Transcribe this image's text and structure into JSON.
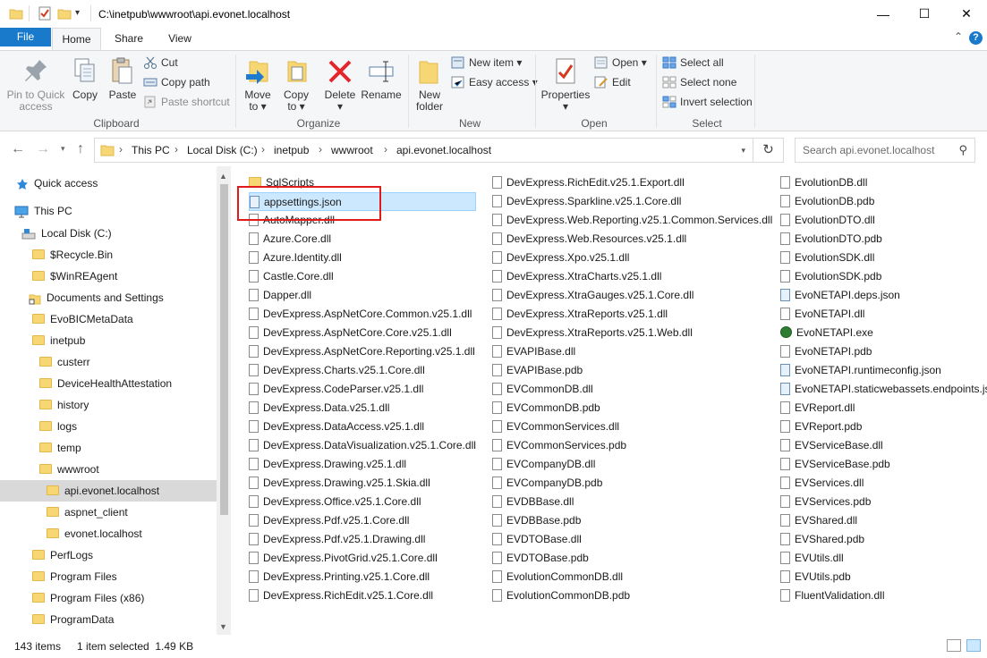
{
  "window": {
    "title": "C:\\inetpub\\wwwroot\\api.evonet.localhost",
    "controls": {
      "minimize": "—",
      "maximize": "☐",
      "close": "✕"
    }
  },
  "ribbon_tabs": [
    "File",
    "Home",
    "Share",
    "View"
  ],
  "ribbon": {
    "clipboard": {
      "pin_label_1": "Pin to Quick",
      "pin_label_2": "access",
      "copy": "Copy",
      "paste": "Paste",
      "cut": "Cut",
      "copy_path": "Copy path",
      "paste_shortcut": "Paste shortcut",
      "group": "Clipboard"
    },
    "organize": {
      "move_to_1": "Move",
      "move_to_2": "to ▾",
      "copy_to_1": "Copy",
      "copy_to_2": "to ▾",
      "delete_1": "Delete",
      "delete_2": "▾",
      "rename": "Rename",
      "group": "Organize"
    },
    "new": {
      "new_folder_1": "New",
      "new_folder_2": "folder",
      "new_item": "New item ▾",
      "easy_access": "Easy access ▾",
      "group": "New"
    },
    "open": {
      "properties_1": "Properties",
      "properties_2": "▾",
      "open": "Open ▾",
      "edit": "Edit",
      "group": "Open"
    },
    "select": {
      "select_all": "Select all",
      "select_none": "Select none",
      "invert_selection": "Invert selection",
      "group": "Select"
    },
    "collapse": "⌃",
    "help": "?"
  },
  "address": {
    "crumbs": [
      "This PC",
      "Local Disk (C:)",
      "inetpub",
      "wwwroot",
      "api.evonet.localhost"
    ],
    "search_placeholder": "Search api.evonet.localhost"
  },
  "nav_pane": [
    {
      "label": "Quick access",
      "type": "quick"
    },
    {
      "label": "This PC",
      "type": "pc"
    },
    {
      "label": "Local Disk (C:)",
      "type": "drive"
    },
    {
      "label": "$Recycle.Bin",
      "type": "folder"
    },
    {
      "label": "$WinREAgent",
      "type": "folder"
    },
    {
      "label": "Documents and Settings",
      "type": "link"
    },
    {
      "label": "EvoBICMetaData",
      "type": "folder"
    },
    {
      "label": "inetpub",
      "type": "folder"
    },
    {
      "label": "custerr",
      "type": "folder"
    },
    {
      "label": "DeviceHealthAttestation",
      "type": "folder"
    },
    {
      "label": "history",
      "type": "folder"
    },
    {
      "label": "logs",
      "type": "folder"
    },
    {
      "label": "temp",
      "type": "folder"
    },
    {
      "label": "wwwroot",
      "type": "folder"
    },
    {
      "label": "api.evonet.localhost",
      "type": "folder",
      "selected": true
    },
    {
      "label": "aspnet_client",
      "type": "folder"
    },
    {
      "label": "evonet.localhost",
      "type": "folder"
    },
    {
      "label": "PerfLogs",
      "type": "folder"
    },
    {
      "label": "Program Files",
      "type": "folder"
    },
    {
      "label": "Program Files (x86)",
      "type": "folder"
    },
    {
      "label": "ProgramData",
      "type": "folder"
    }
  ],
  "files": {
    "col1": [
      {
        "name": "SqlScripts",
        "type": "folder"
      },
      {
        "name": "appsettings.json",
        "type": "json",
        "selected": true
      },
      {
        "name": "AutoMapper.dll",
        "type": "file"
      },
      {
        "name": "Azure.Core.dll",
        "type": "file"
      },
      {
        "name": "Azure.Identity.dll",
        "type": "file"
      },
      {
        "name": "Castle.Core.dll",
        "type": "file"
      },
      {
        "name": "Dapper.dll",
        "type": "file"
      },
      {
        "name": "DevExpress.AspNetCore.Common.v25.1.dll",
        "type": "file"
      },
      {
        "name": "DevExpress.AspNetCore.Core.v25.1.dll",
        "type": "file"
      },
      {
        "name": "DevExpress.AspNetCore.Reporting.v25.1.dll",
        "type": "file"
      },
      {
        "name": "DevExpress.Charts.v25.1.Core.dll",
        "type": "file"
      },
      {
        "name": "DevExpress.CodeParser.v25.1.dll",
        "type": "file"
      },
      {
        "name": "DevExpress.Data.v25.1.dll",
        "type": "file"
      },
      {
        "name": "DevExpress.DataAccess.v25.1.dll",
        "type": "file"
      },
      {
        "name": "DevExpress.DataVisualization.v25.1.Core.dll",
        "type": "file"
      },
      {
        "name": "DevExpress.Drawing.v25.1.dll",
        "type": "file"
      },
      {
        "name": "DevExpress.Drawing.v25.1.Skia.dll",
        "type": "file"
      },
      {
        "name": "DevExpress.Office.v25.1.Core.dll",
        "type": "file"
      },
      {
        "name": "DevExpress.Pdf.v25.1.Core.dll",
        "type": "file"
      },
      {
        "name": "DevExpress.Pdf.v25.1.Drawing.dll",
        "type": "file"
      },
      {
        "name": "DevExpress.PivotGrid.v25.1.Core.dll",
        "type": "file"
      },
      {
        "name": "DevExpress.Printing.v25.1.Core.dll",
        "type": "file"
      },
      {
        "name": "DevExpress.RichEdit.v25.1.Core.dll",
        "type": "file"
      }
    ],
    "col2": [
      {
        "name": "DevExpress.RichEdit.v25.1.Export.dll",
        "type": "file"
      },
      {
        "name": "DevExpress.Sparkline.v25.1.Core.dll",
        "type": "file"
      },
      {
        "name": "DevExpress.Web.Reporting.v25.1.Common.Services.dll",
        "type": "file"
      },
      {
        "name": "DevExpress.Web.Resources.v25.1.dll",
        "type": "file"
      },
      {
        "name": "DevExpress.Xpo.v25.1.dll",
        "type": "file"
      },
      {
        "name": "DevExpress.XtraCharts.v25.1.dll",
        "type": "file"
      },
      {
        "name": "DevExpress.XtraGauges.v25.1.Core.dll",
        "type": "file"
      },
      {
        "name": "DevExpress.XtraReports.v25.1.dll",
        "type": "file"
      },
      {
        "name": "DevExpress.XtraReports.v25.1.Web.dll",
        "type": "file"
      },
      {
        "name": "EVAPIBase.dll",
        "type": "file"
      },
      {
        "name": "EVAPIBase.pdb",
        "type": "file"
      },
      {
        "name": "EVCommonDB.dll",
        "type": "file"
      },
      {
        "name": "EVCommonDB.pdb",
        "type": "file"
      },
      {
        "name": "EVCommonServices.dll",
        "type": "file"
      },
      {
        "name": "EVCommonServices.pdb",
        "type": "file"
      },
      {
        "name": "EVCompanyDB.dll",
        "type": "file"
      },
      {
        "name": "EVCompanyDB.pdb",
        "type": "file"
      },
      {
        "name": "EVDBBase.dll",
        "type": "file"
      },
      {
        "name": "EVDBBase.pdb",
        "type": "file"
      },
      {
        "name": "EVDTOBase.dll",
        "type": "file"
      },
      {
        "name": "EVDTOBase.pdb",
        "type": "file"
      },
      {
        "name": "EvolutionCommonDB.dll",
        "type": "file"
      },
      {
        "name": "EvolutionCommonDB.pdb",
        "type": "file"
      }
    ],
    "col3": [
      {
        "name": "EvolutionDB.dll",
        "type": "file"
      },
      {
        "name": "EvolutionDB.pdb",
        "type": "file"
      },
      {
        "name": "EvolutionDTO.dll",
        "type": "file"
      },
      {
        "name": "EvolutionDTO.pdb",
        "type": "file"
      },
      {
        "name": "EvolutionSDK.dll",
        "type": "file"
      },
      {
        "name": "EvolutionSDK.pdb",
        "type": "file"
      },
      {
        "name": "EvoNETAPI.deps.json",
        "type": "json"
      },
      {
        "name": "EvoNETAPI.dll",
        "type": "file"
      },
      {
        "name": "EvoNETAPI.exe",
        "type": "exe"
      },
      {
        "name": "EvoNETAPI.pdb",
        "type": "file"
      },
      {
        "name": "EvoNETAPI.runtimeconfig.json",
        "type": "json"
      },
      {
        "name": "EvoNETAPI.staticwebassets.endpoints.json",
        "type": "json"
      },
      {
        "name": "EVReport.dll",
        "type": "file"
      },
      {
        "name": "EVReport.pdb",
        "type": "file"
      },
      {
        "name": "EVServiceBase.dll",
        "type": "file"
      },
      {
        "name": "EVServiceBase.pdb",
        "type": "file"
      },
      {
        "name": "EVServices.dll",
        "type": "file"
      },
      {
        "name": "EVServices.pdb",
        "type": "file"
      },
      {
        "name": "EVShared.dll",
        "type": "file"
      },
      {
        "name": "EVShared.pdb",
        "type": "file"
      },
      {
        "name": "EVUtils.dll",
        "type": "file"
      },
      {
        "name": "EVUtils.pdb",
        "type": "file"
      },
      {
        "name": "FluentValidation.dll",
        "type": "file"
      }
    ]
  },
  "status": {
    "item_count": "143 items",
    "selection": "1 item selected  1.49 KB"
  },
  "colors": {
    "accent": "#1979ca",
    "selection": "#cce8ff",
    "highlight_box": "#e11b1b"
  }
}
